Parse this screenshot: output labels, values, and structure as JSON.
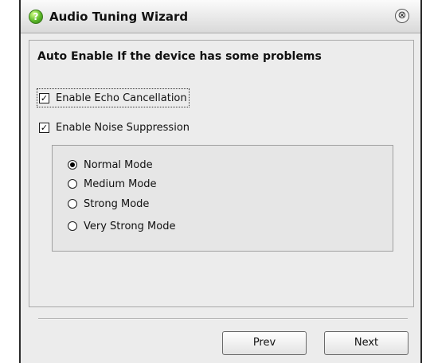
{
  "window": {
    "title": "Audio Tuning Wizard",
    "title_icon": "?",
    "close_glyph": "⊗"
  },
  "content": {
    "heading": "Auto Enable If the device has some problems",
    "options": [
      {
        "label": "Enable Echo Cancellation",
        "checked": true,
        "mark": "✓"
      },
      {
        "label": "Enable Noise Suppression",
        "checked": true,
        "mark": "✓"
      }
    ],
    "modes": [
      {
        "label": "Normal Mode",
        "selected": true
      },
      {
        "label": "Medium Mode",
        "selected": false
      },
      {
        "label": "Strong Mode",
        "selected": false
      },
      {
        "label": "Very Strong Mode",
        "selected": false
      }
    ]
  },
  "buttons": {
    "prev": "Prev",
    "next": "Next"
  }
}
